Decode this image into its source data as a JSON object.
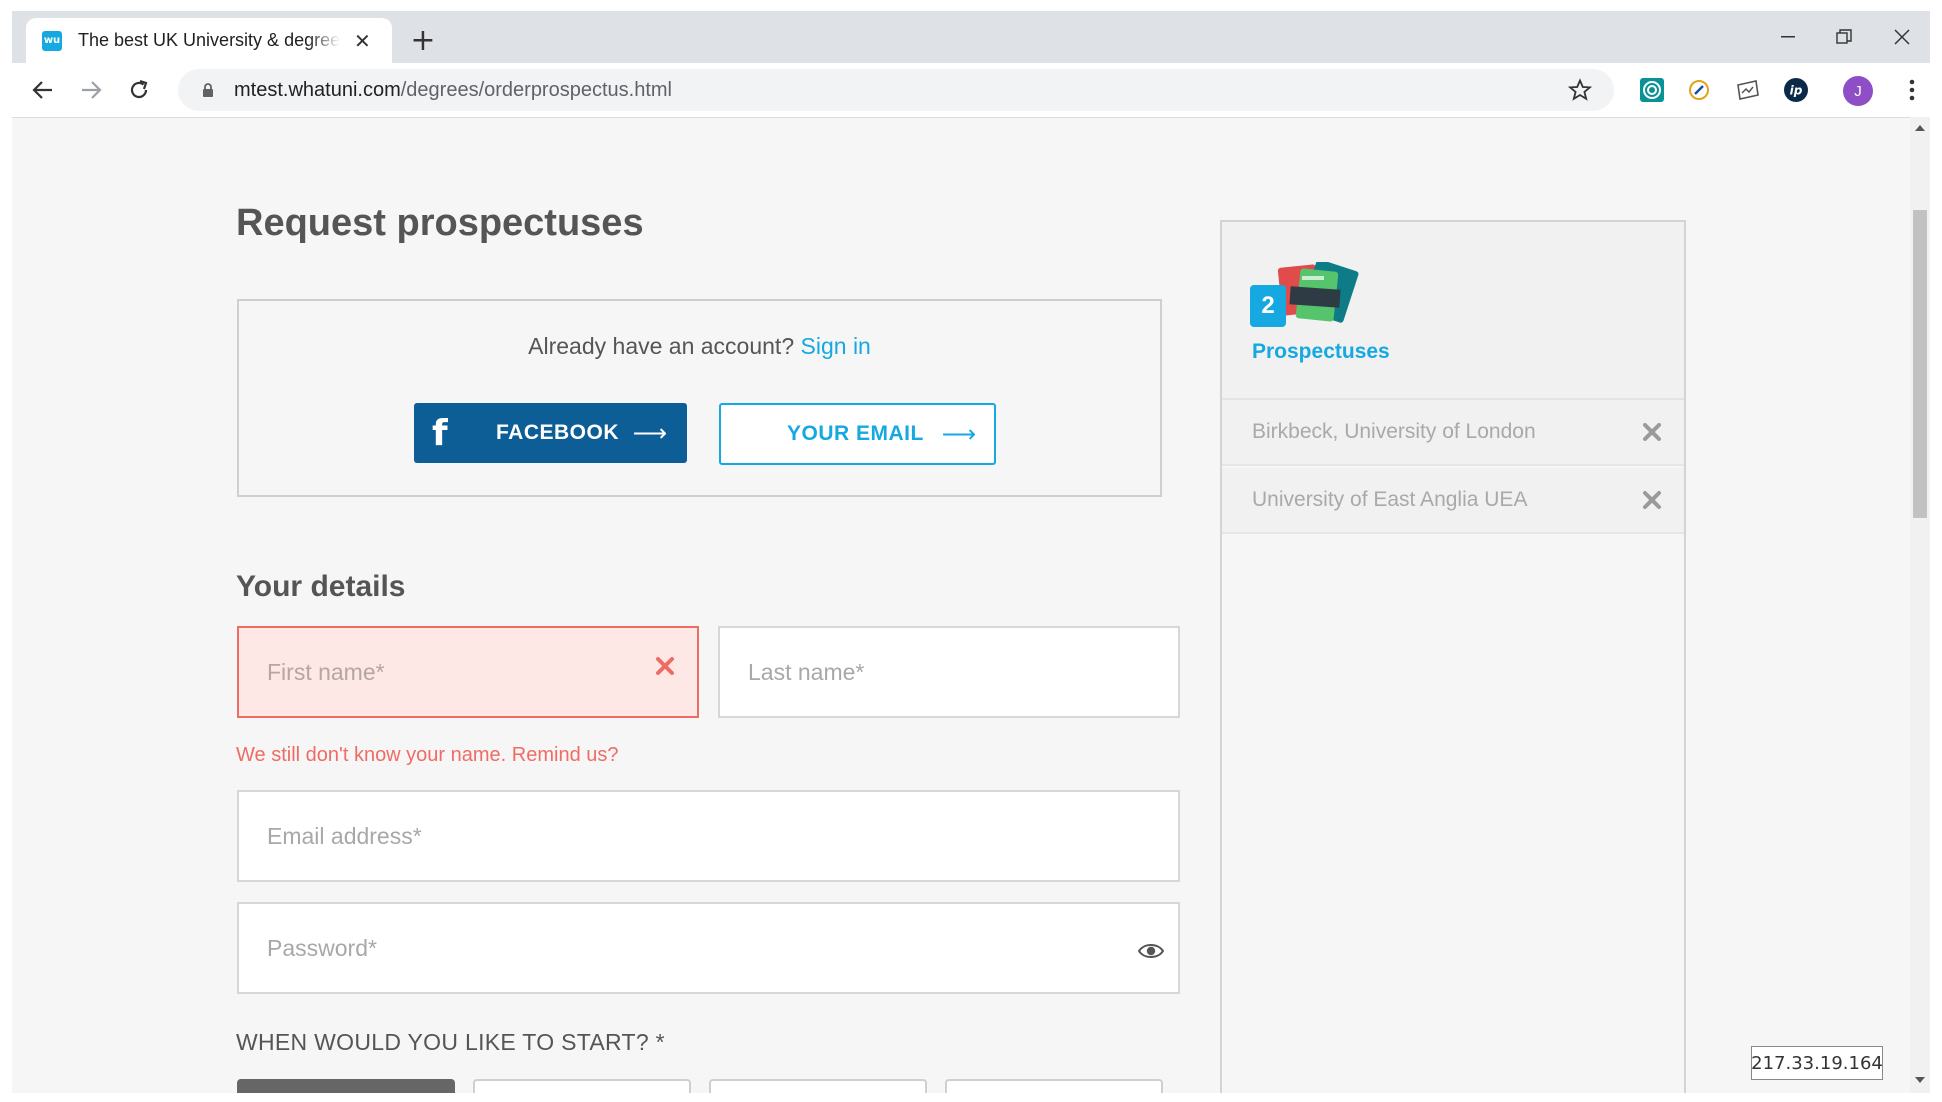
{
  "browser": {
    "tab_title": "The best UK University & degree",
    "tab_close": "✕",
    "new_tab": "+",
    "favicon_text": "wu",
    "url_host": "mtest.whatuni.com",
    "url_path": "/degrees/orderprospectus.html",
    "profile_initial": "J"
  },
  "page": {
    "title": "Request prospectuses",
    "signin": {
      "prompt": "Already have an account?",
      "link": "Sign in",
      "facebook_label": "FACEBOOK",
      "email_label": "YOUR EMAIL",
      "arrow": "⟶"
    },
    "details": {
      "title": "Your details",
      "first_name_placeholder": "First name*",
      "last_name_placeholder": "Last name*",
      "first_name_error": "We still don't know your name. Remind us?",
      "email_placeholder": "Email address*",
      "password_placeholder": "Password*"
    },
    "start": {
      "label": "WHEN WOULD YOU LIKE TO START? *"
    }
  },
  "sidebar": {
    "count": "2",
    "label": "Prospectuses",
    "universities": [
      {
        "name": "Birkbeck, University of London"
      },
      {
        "name": "University of East Anglia UEA"
      }
    ]
  },
  "ip_address": "217.33.19.164",
  "colors": {
    "brand": "#16a9e1",
    "facebook": "#0d5e96",
    "error": "#ef6c65"
  }
}
